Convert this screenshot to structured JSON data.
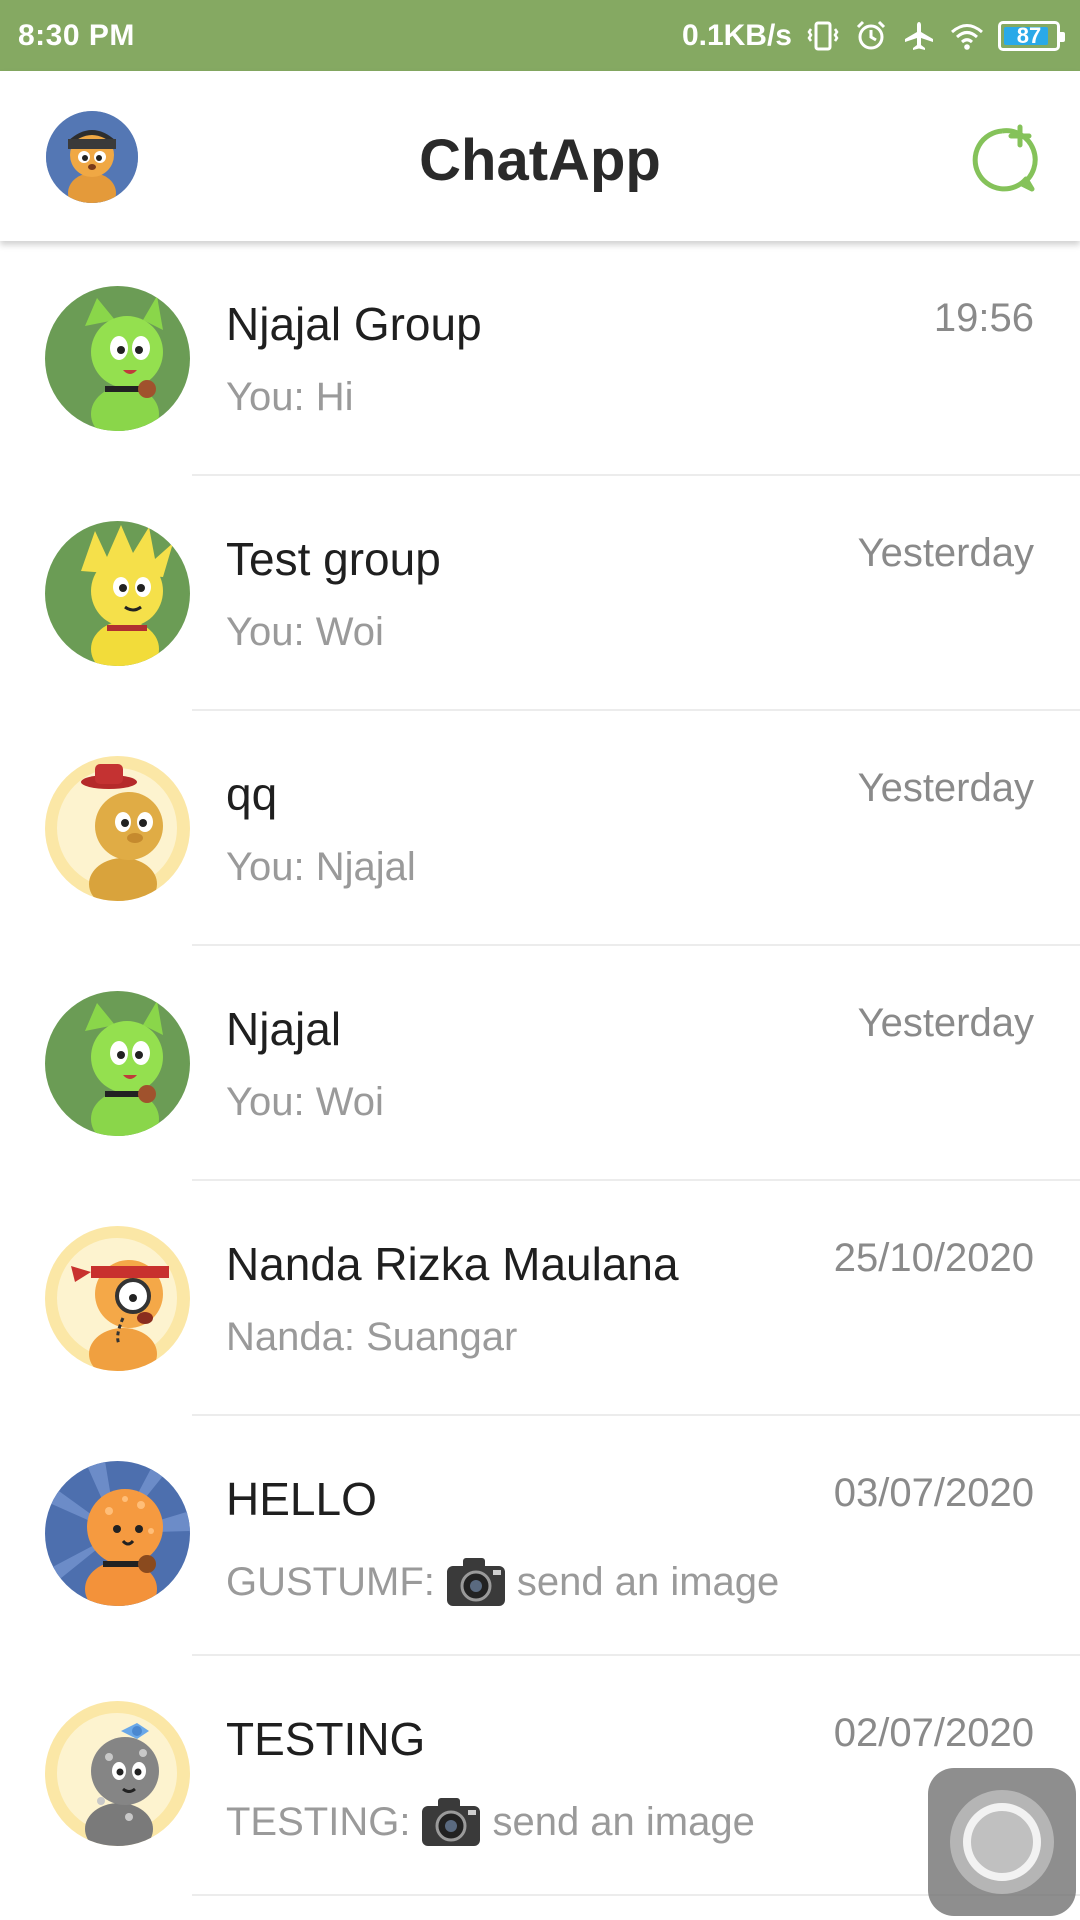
{
  "status_bar": {
    "time": "8:30 PM",
    "network_speed": "0.1KB/s",
    "battery_level": "87",
    "battery_fraction": 0.87,
    "icons": [
      "vibrate-icon",
      "alarm-icon",
      "airplane-mode-icon",
      "wifi-icon",
      "battery-icon"
    ],
    "background_color": "#85a962"
  },
  "app_bar": {
    "title": "ChatApp",
    "profile_avatar": "profile-avatar",
    "new_chat_icon": "new-chat-icon",
    "accent_color": "#85c25a"
  },
  "chats": [
    {
      "name": "Njajal Group",
      "sender": "You:",
      "message": "Hi",
      "time": "19:56",
      "has_image": false,
      "avatar": "green-cat-avatar"
    },
    {
      "name": "Test group",
      "sender": "You:",
      "message": "Woi",
      "time": "Yesterday",
      "has_image": false,
      "avatar": "yellow-spiky-cat-avatar"
    },
    {
      "name": "qq",
      "sender": "You:",
      "message": "Njajal",
      "time": "Yesterday",
      "has_image": false,
      "avatar": "hat-cat-avatar"
    },
    {
      "name": "Njajal",
      "sender": "You:",
      "message": "Woi",
      "time": "Yesterday",
      "has_image": false,
      "avatar": "green-cat-avatar"
    },
    {
      "name": "Nanda Rizka Maulana",
      "sender": "Nanda:",
      "message": "Suangar",
      "time": "25/10/2020",
      "has_image": false,
      "avatar": "monocle-cat-avatar"
    },
    {
      "name": "HELLO",
      "sender": "GUSTUMF:",
      "message": "send an image",
      "time": "03/07/2020",
      "has_image": true,
      "avatar": "orange-spotted-cat-avatar"
    },
    {
      "name": "TESTING",
      "sender": "TESTING:",
      "message": "send an image",
      "time": "02/07/2020",
      "has_image": true,
      "avatar": "gray-bow-cat-avatar"
    }
  ]
}
